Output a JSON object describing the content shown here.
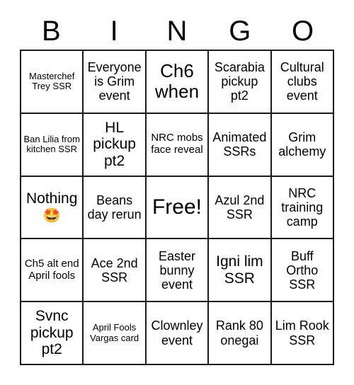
{
  "card": {
    "title": "BINGO",
    "header_letters": [
      "B",
      "I",
      "N",
      "G",
      "O"
    ],
    "grid_size": "5x5",
    "colors": {
      "background": "#ffffff",
      "border": "#1a1a1a",
      "text": "#000000"
    },
    "rows": [
      [
        {
          "text": "Masterchef Trey SSR",
          "size": "xs"
        },
        {
          "text": "Everyone is Grim event",
          "size": "md"
        },
        {
          "text": "Ch6 when",
          "size": "xl"
        },
        {
          "text": "Scarabia pickup pt2",
          "size": "md"
        },
        {
          "text": "Cultural clubs event",
          "size": "md"
        }
      ],
      [
        {
          "text": "Ban Lilia from kitchen SSR",
          "size": "xs"
        },
        {
          "text": "HL pickup pt2",
          "size": "lg"
        },
        {
          "text": "NRC mobs face reveal",
          "size": "sm"
        },
        {
          "text": "Animated SSRs",
          "size": "md"
        },
        {
          "text": "Grim alchemy",
          "size": "md"
        }
      ],
      [
        {
          "text": "Nothing",
          "size": "lg",
          "emoji": "🤩"
        },
        {
          "text": "Beans day rerun",
          "size": "md"
        },
        {
          "text": "Free!",
          "size": "free"
        },
        {
          "text": "Azul 2nd SSR",
          "size": "md"
        },
        {
          "text": "NRC training camp",
          "size": "md"
        }
      ],
      [
        {
          "text": "Ch5 alt end April fools",
          "size": "sm"
        },
        {
          "text": "Ace 2nd SSR",
          "size": "md"
        },
        {
          "text": "Easter bunny event",
          "size": "md"
        },
        {
          "text": "Igni lim SSR",
          "size": "lg"
        },
        {
          "text": "Buff Ortho SSR",
          "size": "md"
        }
      ],
      [
        {
          "text": "Svnc pickup pt2",
          "size": "lg"
        },
        {
          "text": "April Fools Vargas card",
          "size": "xs"
        },
        {
          "text": "Clownley event",
          "size": "md"
        },
        {
          "text": "Rank 80 onegai",
          "size": "md"
        },
        {
          "text": "Lim Rook SSR",
          "size": "md"
        }
      ]
    ]
  }
}
